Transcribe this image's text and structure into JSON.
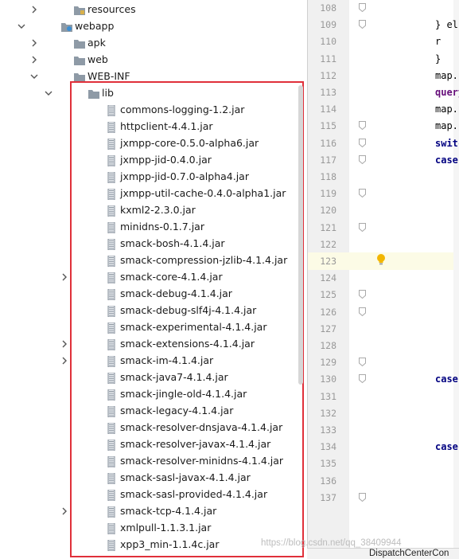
{
  "tree": {
    "items": [
      {
        "label": "resources",
        "type": "folder-res",
        "arrow": "right",
        "level": 4
      },
      {
        "label": "webapp",
        "type": "folder-web",
        "arrow": "down",
        "level": 3
      },
      {
        "label": "apk",
        "type": "folder",
        "arrow": "right",
        "level": 4
      },
      {
        "label": "web",
        "type": "folder",
        "arrow": "right",
        "level": 4
      },
      {
        "label": "WEB-INF",
        "type": "folder",
        "arrow": "down",
        "level": 4
      },
      {
        "label": "lib",
        "type": "folder",
        "arrow": "down",
        "level": 5
      },
      {
        "label": "commons-logging-1.2.jar",
        "type": "jar",
        "arrow": "",
        "level": 6
      },
      {
        "label": "httpclient-4.4.1.jar",
        "type": "jar",
        "arrow": "",
        "level": 6
      },
      {
        "label": "jxmpp-core-0.5.0-alpha6.jar",
        "type": "jar",
        "arrow": "",
        "level": 6
      },
      {
        "label": "jxmpp-jid-0.4.0.jar",
        "type": "jar",
        "arrow": "",
        "level": 6
      },
      {
        "label": "jxmpp-jid-0.7.0-alpha4.jar",
        "type": "jar",
        "arrow": "",
        "level": 6
      },
      {
        "label": "jxmpp-util-cache-0.4.0-alpha1.jar",
        "type": "jar",
        "arrow": "",
        "level": 6
      },
      {
        "label": "kxml2-2.3.0.jar",
        "type": "jar",
        "arrow": "",
        "level": 6
      },
      {
        "label": "minidns-0.1.7.jar",
        "type": "jar",
        "arrow": "",
        "level": 6
      },
      {
        "label": "smack-bosh-4.1.4.jar",
        "type": "jar",
        "arrow": "",
        "level": 6
      },
      {
        "label": "smack-compression-jzlib-4.1.4.jar",
        "type": "jar",
        "arrow": "",
        "level": 6
      },
      {
        "label": "smack-core-4.1.4.jar",
        "type": "jar",
        "arrow": "right",
        "level": 6
      },
      {
        "label": "smack-debug-4.1.4.jar",
        "type": "jar",
        "arrow": "",
        "level": 6
      },
      {
        "label": "smack-debug-slf4j-4.1.4.jar",
        "type": "jar",
        "arrow": "",
        "level": 6
      },
      {
        "label": "smack-experimental-4.1.4.jar",
        "type": "jar",
        "arrow": "",
        "level": 6
      },
      {
        "label": "smack-extensions-4.1.4.jar",
        "type": "jar",
        "arrow": "right",
        "level": 6
      },
      {
        "label": "smack-im-4.1.4.jar",
        "type": "jar",
        "arrow": "right",
        "level": 6
      },
      {
        "label": "smack-java7-4.1.4.jar",
        "type": "jar",
        "arrow": "",
        "level": 6
      },
      {
        "label": "smack-jingle-old-4.1.4.jar",
        "type": "jar",
        "arrow": "",
        "level": 6
      },
      {
        "label": "smack-legacy-4.1.4.jar",
        "type": "jar",
        "arrow": "",
        "level": 6
      },
      {
        "label": "smack-resolver-dnsjava-4.1.4.jar",
        "type": "jar",
        "arrow": "",
        "level": 6
      },
      {
        "label": "smack-resolver-javax-4.1.4.jar",
        "type": "jar",
        "arrow": "",
        "level": 6
      },
      {
        "label": "smack-resolver-minidns-4.1.4.jar",
        "type": "jar",
        "arrow": "",
        "level": 6
      },
      {
        "label": "smack-sasl-javax-4.1.4.jar",
        "type": "jar",
        "arrow": "",
        "level": 6
      },
      {
        "label": "smack-sasl-provided-4.1.4.jar",
        "type": "jar",
        "arrow": "",
        "level": 6
      },
      {
        "label": "smack-tcp-4.1.4.jar",
        "type": "jar",
        "arrow": "right",
        "level": 6
      },
      {
        "label": "xmlpull-1.1.3.1.jar",
        "type": "jar",
        "arrow": "",
        "level": 6
      },
      {
        "label": "xpp3_min-1.1.4c.jar",
        "type": "jar",
        "arrow": "",
        "level": 6
      }
    ]
  },
  "editor": {
    "line_numbers": [
      "108",
      "109",
      "110",
      "111",
      "112",
      "113",
      "114",
      "115",
      "116",
      "117",
      "118",
      "119",
      "120",
      "121",
      "122",
      "123",
      "124",
      "125",
      "126",
      "127",
      "128",
      "129",
      "130",
      "131",
      "132",
      "133",
      "134",
      "135",
      "136",
      "137"
    ],
    "current_line": "122",
    "code": [
      {
        "line": "109",
        "text": "} el",
        "style": "plain"
      },
      {
        "line": "110",
        "text": "r",
        "style": "plain"
      },
      {
        "line": "111",
        "text": "}",
        "style": "plain"
      },
      {
        "line": "112",
        "text": "map.p",
        "style": "plain"
      },
      {
        "line": "113",
        "text": "query",
        "style": "pur"
      },
      {
        "line": "114",
        "text": "map.p",
        "style": "plain"
      },
      {
        "line": "115",
        "text": "map.p",
        "style": "plain"
      },
      {
        "line": "116",
        "text": "switc",
        "style": "kw"
      },
      {
        "line": "117",
        "text": "case",
        "style": "kw"
      },
      {
        "line": "130",
        "text": "case",
        "style": "kw"
      },
      {
        "line": "134",
        "text": "case",
        "style": "kw"
      }
    ],
    "tab_label": "DispatchCenterCon",
    "watermark": "https://blog.csdn.net/qq_38409944"
  },
  "colors": {
    "highlight_border": "#e0303a",
    "folder": "#8e9aa6",
    "keyword": "#000080",
    "current_line": "#fcfbe6",
    "bulb": "#f2b600"
  }
}
